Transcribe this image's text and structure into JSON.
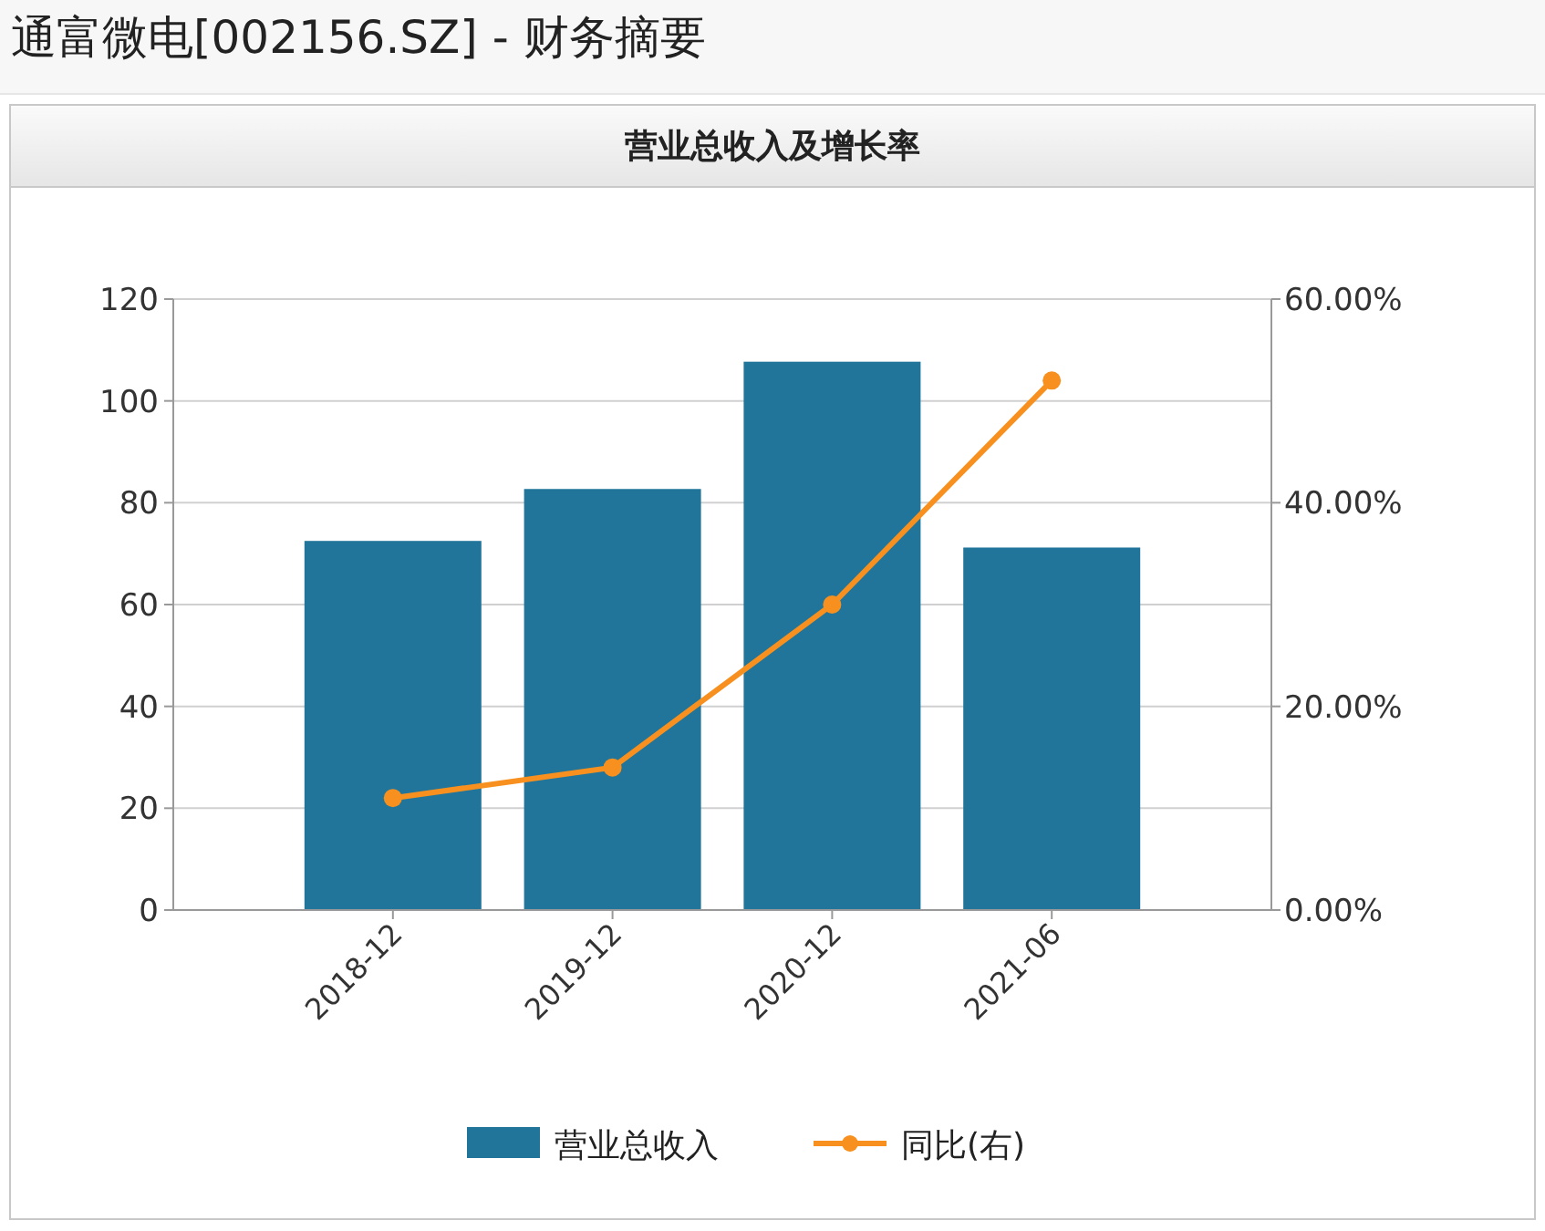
{
  "page_title": "通富微电[002156.SZ] - 财务摘要",
  "panel": {
    "title": "营业总收入及增长率",
    "chart_data": {
      "type": "bar",
      "categories": [
        "2018-12",
        "2019-12",
        "2020-12",
        "2021-06"
      ],
      "grid": true,
      "legend": true,
      "ylim": [
        0,
        120
      ],
      "yticks": [
        0,
        20,
        40,
        60,
        80,
        100,
        120
      ],
      "y2lim": [
        0,
        0.6
      ],
      "y2ticks": [
        {
          "value": 0,
          "label": "0.00%"
        },
        {
          "value": 0.2,
          "label": "20.00%"
        },
        {
          "value": 0.4,
          "label": "40.00%"
        },
        {
          "value": 0.6,
          "label": "60.00%"
        }
      ],
      "series": [
        {
          "name": "营业总收入",
          "color": "#21759b",
          "values": [
            72.5,
            82.7,
            107.7,
            71.2
          ]
        },
        {
          "name": "同比(右)",
          "type": "line",
          "axis": "y2",
          "marker": "circle",
          "color": "#f7901e",
          "values": [
            0.11,
            0.14,
            0.3,
            0.52
          ]
        }
      ]
    }
  }
}
